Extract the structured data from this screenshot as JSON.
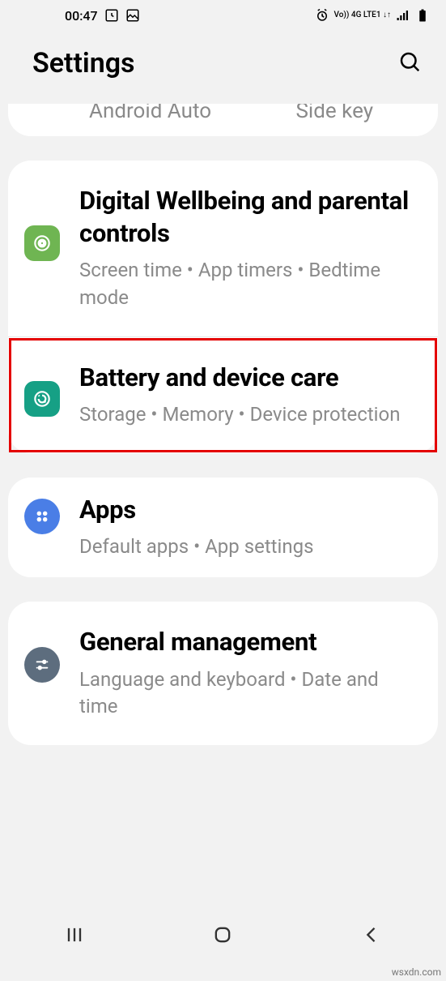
{
  "status": {
    "time": "00:47",
    "net_label": "Vo)) 4G LTE1 ↓↑"
  },
  "header": {
    "title": "Settings"
  },
  "partial": {
    "t1": "Android Auto",
    "t2": "Side key"
  },
  "items": [
    {
      "title": "Digital Wellbeing and parental controls",
      "sub": "Screen time  •  App timers  •  Bedtime mode"
    },
    {
      "title": "Battery and device care",
      "sub": "Storage  •  Memory  •  Device protection"
    },
    {
      "title": "Apps",
      "sub": "Default apps  •  App settings"
    },
    {
      "title": "General management",
      "sub": "Language and keyboard  •  Date and time"
    }
  ],
  "watermark": "wsxdn.com"
}
